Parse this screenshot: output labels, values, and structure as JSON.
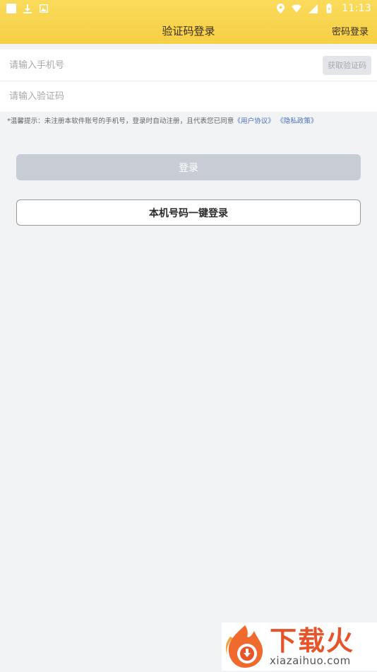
{
  "status_bar": {
    "time": "11:13",
    "left_icons": [
      "notification-square-icon",
      "download-icon",
      "image-icon"
    ],
    "right_icons": [
      "location-icon",
      "wifi-icon",
      "signal-icon",
      "battery-icon"
    ]
  },
  "navbar": {
    "title": "验证码登录",
    "right_action": "密码登录"
  },
  "form": {
    "phone_placeholder": "请输入手机号",
    "phone_value": "",
    "get_code_label": "获取验证码",
    "code_placeholder": "请输入验证码",
    "code_value": ""
  },
  "tip": {
    "text": "*温馨提示：未注册本软件账号的手机号，登录时自动注册，且代表您已同意",
    "user_agreement": "《用户协议》",
    "privacy_policy": "《隐私政策》"
  },
  "buttons": {
    "login_label": "登录",
    "onekey_label": "本机号码一键登录"
  },
  "watermark": {
    "brand": "下载火",
    "domain": "xiazaihuo.com"
  },
  "colors": {
    "header_yellow": "#f7cf44",
    "background": "#f2f3f5",
    "login_disabled": "#c8ccd4",
    "link_blue": "#4a72b8",
    "watermark_orange": "#e8542a"
  }
}
